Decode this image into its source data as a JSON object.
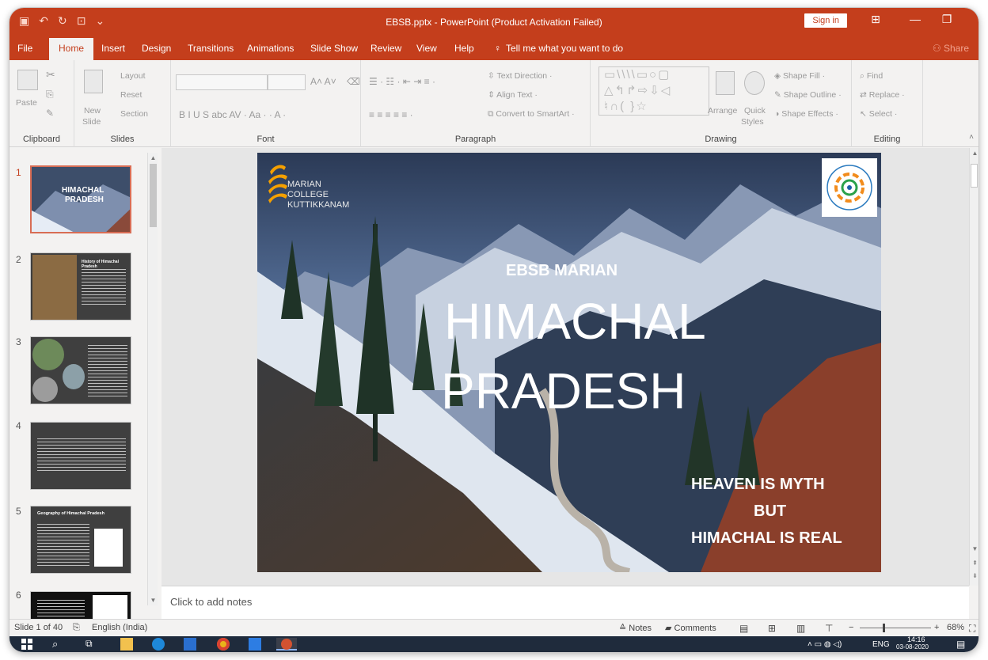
{
  "window": {
    "title": "EBSB.pptx  -  PowerPoint (Product Activation Failed)",
    "sign_in": "Sign in",
    "min": "—",
    "restore": "❐",
    "ribbon_display": "⊞"
  },
  "tabs": [
    {
      "label": "File"
    },
    {
      "label": "Home"
    },
    {
      "label": "Insert"
    },
    {
      "label": "Design"
    },
    {
      "label": "Transitions"
    },
    {
      "label": "Animations"
    },
    {
      "label": "Slide Show"
    },
    {
      "label": "Review"
    },
    {
      "label": "View"
    },
    {
      "label": "Help"
    }
  ],
  "tell_me": "Tell me what you want to do",
  "share": "Share",
  "ribbon": {
    "clipboard": {
      "label": "Clipboard",
      "paste": "Paste"
    },
    "slides": {
      "label": "Slides",
      "new": "New",
      "slide": "Slide",
      "layout": "Layout",
      "reset": "Reset",
      "section": "Section"
    },
    "font": {
      "label": "Font",
      "row2": "B   I   U   S  abc  AV ·  Aa ·    ·  A ·"
    },
    "paragraph": {
      "label": "Paragraph",
      "text_direction": "Text Direction",
      "align_text": "Align Text",
      "convert": "Convert to SmartArt"
    },
    "drawing": {
      "label": "Drawing",
      "arrange": "Arrange",
      "quick_styles_1": "Quick",
      "quick_styles_2": "Styles",
      "shape_fill": "Shape Fill",
      "shape_outline": "Shape Outline",
      "shape_effects": "Shape Effects"
    },
    "editing": {
      "label": "Editing",
      "find": "Find",
      "replace": "Replace",
      "select": "Select"
    }
  },
  "thumbnails": [
    {
      "num": "1",
      "title1": "HIMACHAL",
      "title2": "PRADESH"
    },
    {
      "num": "2",
      "title1": "History of Himachal Pradesh"
    },
    {
      "num": "3"
    },
    {
      "num": "4"
    },
    {
      "num": "5",
      "title1": "Geography of Himachal Pradesh"
    },
    {
      "num": "6"
    }
  ],
  "slide": {
    "college_line1": "MARIAN COLLEGE",
    "college_line2": "KUTTIKKANAM",
    "kicker": "EBSB MARIAN",
    "title1": "HIMACHAL",
    "title2": "PRADESH",
    "tag1": "HEAVEN IS MYTH",
    "tag2": "BUT",
    "tag3": "HIMACHAL IS REAL"
  },
  "notes_placeholder": "Click to add notes",
  "status": {
    "slide_of": "Slide 1 of 40",
    "language": "English (India)",
    "notes": "Notes",
    "comments": "Comments",
    "zoom": "68%"
  },
  "taskbar": {
    "lang": "ENG",
    "time": "14:16",
    "date": "03-08-2020"
  },
  "colors": {
    "accent": "#c43e1c",
    "taskbar": "#1f2b3c"
  }
}
